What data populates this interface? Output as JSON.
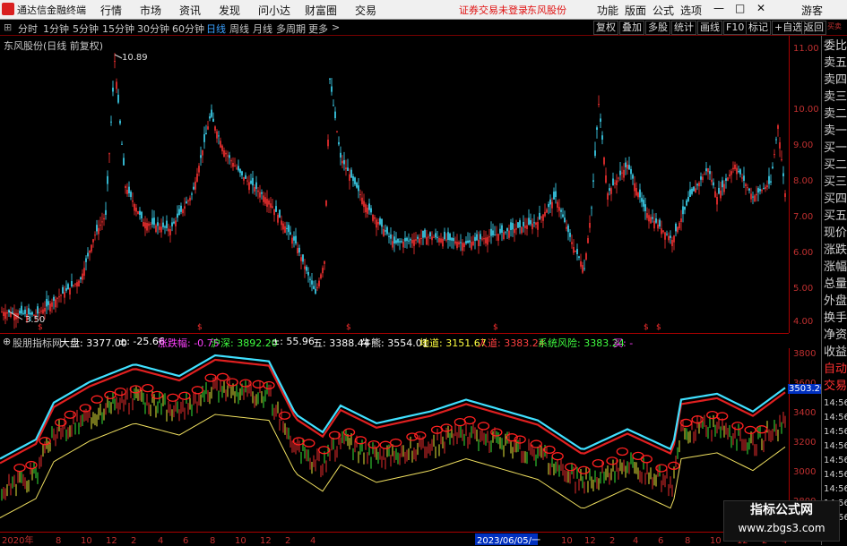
{
  "app": {
    "name": "通达信金融终端"
  },
  "menu": [
    "行情",
    "市场",
    "资讯",
    "发现",
    "问小达",
    "财富圈",
    "交易"
  ],
  "notice": {
    "trade_status": "证券交易未登录",
    "stock": "东风股份"
  },
  "right_menu": [
    "功能",
    "版面",
    "公式",
    "选项"
  ],
  "user": "游客",
  "periods": [
    "分时",
    "1分钟",
    "5分钟",
    "15分钟",
    "30分钟",
    "60分钟",
    "日线",
    "周线",
    "月线",
    "多周期",
    "更多"
  ],
  "active_period": "日线",
  "toolbar": [
    "复权",
    "叠加",
    "多股",
    "统计",
    "画线",
    "F10",
    "标记",
    "+自选",
    "返回"
  ],
  "chart_title": "东风股份(日线 前复权)",
  "price_axis": [
    "11.00",
    "10.00",
    "9.00",
    "8.00",
    "7.00",
    "6.00",
    "5.00",
    "4.00"
  ],
  "annotations": {
    "high": "10.89",
    "low": "3.50"
  },
  "indicator_bar": [
    {
      "label": "股朋指标网",
      "color": "#d0d0d0"
    },
    {
      "label": "大盘: 3377.00",
      "color": "#ffffff"
    },
    {
      "label": "±: -25.66",
      "color": "#ffffff"
    },
    {
      "label": "涨跌幅: -0.75",
      "color": "#ff40ff"
    },
    {
      "label": "沪深: 3892.20",
      "color": "#40ff40"
    },
    {
      "label": "±: 55.96",
      "color": "#ffffff"
    },
    {
      "label": "五: 3388.44",
      "color": "#ffffff"
    },
    {
      "label": "牛熊: 3554.01",
      "color": "#ffffff"
    },
    {
      "label": "地道: 3151.67",
      "color": "#ffff40"
    },
    {
      "label": "人道: 3383.24",
      "color": "#ff4040"
    },
    {
      "label": "系统风险: 3383.24",
      "color": "#40ff40"
    },
    {
      "label": "买: -",
      "color": "#ff40ff"
    }
  ],
  "sub_axis": [
    "3800",
    "3600",
    "3400",
    "3200",
    "3000",
    "2800"
  ],
  "sub_current": "3503.20",
  "date_labels": [
    "2020年",
    "8",
    "10",
    "12",
    "2",
    "4",
    "6",
    "8",
    "10",
    "12",
    "2",
    "4",
    "2023/06/05/一",
    "10",
    "12",
    "2",
    "4",
    "6",
    "8",
    "10",
    "12",
    "2",
    "4"
  ],
  "side_tabs": [
    "委比",
    "卖五",
    "卖四",
    "卖三",
    "卖二",
    "卖一",
    "买一",
    "买二",
    "买三",
    "买四",
    "买五",
    "现价",
    "涨跌",
    "涨幅",
    "总量",
    "外盘",
    "换手",
    "净资",
    "收益",
    "自动",
    "交易",
    "14:56",
    "14:56",
    "14:56",
    "14:56",
    "14:56",
    "14:56",
    "14:56",
    "14:56",
    "14:56"
  ],
  "side_top": [
    "买卖",
    "1000"
  ],
  "watermark": {
    "line1": "指标公式网",
    "line2": "www.zbgs3.com"
  },
  "colors": {
    "up": "#ff3333",
    "down": "#40e0ff",
    "frame": "#a00000",
    "yellow": "#f0e060"
  }
}
